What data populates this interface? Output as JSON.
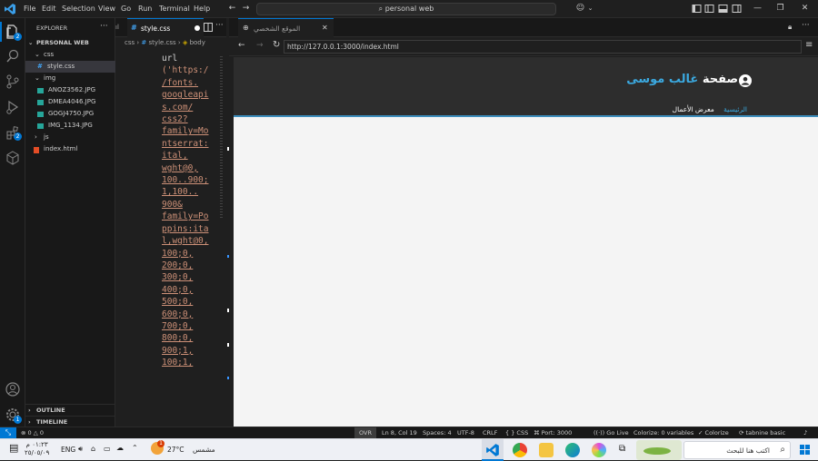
{
  "titlebar": {
    "menu": [
      "File",
      "Edit",
      "Selection",
      "View",
      "Go",
      "Run",
      "Terminal",
      "Help"
    ],
    "search": "personal web"
  },
  "activity": {
    "explorer_badge": "2",
    "scm_badge": "2",
    "settings_badge": "1"
  },
  "explorer": {
    "title": "EXPLORER",
    "workspace": "PERSONAL WEB",
    "tree": [
      {
        "label": "css",
        "type": "folder"
      },
      {
        "label": "style.css",
        "type": "css",
        "selected": true
      },
      {
        "label": "img",
        "type": "folder"
      },
      {
        "label": "ANOZ3562.JPG",
        "type": "image"
      },
      {
        "label": "DMEA4046.JPG",
        "type": "image"
      },
      {
        "label": "GOGJ4750.JPG",
        "type": "image"
      },
      {
        "label": "IMG_1134.JPG",
        "type": "image"
      },
      {
        "label": "js",
        "type": "folder"
      },
      {
        "label": "index.html",
        "type": "html"
      }
    ],
    "outline": "OUTLINE",
    "timeline": "TIMELINE"
  },
  "editor": {
    "tab_prev": "ıl",
    "tab_active": "style.css",
    "breadcrumb": [
      "css",
      "style.css",
      "body"
    ],
    "code_lines": [
      "url",
      "('https:/",
      "/fonts.",
      "googleapi",
      "s.com/",
      "css2?",
      "family=Mo",
      "ntserrat:",
      "ital,",
      "wght@0,",
      "100..900;",
      "1,100..",
      "900&",
      "family=Po",
      "ppins:ita",
      "l,wght@0,",
      "100;0,",
      "200;0,",
      "300;0,",
      "400;0,",
      "500;0,",
      "600;0,",
      "700;0,",
      "800;0,",
      "900;1,",
      "100;1,"
    ]
  },
  "browser": {
    "tab_title": "الموقع الشخصي",
    "url": "http://127.0.0.1:3000/index.html",
    "site_title_main": "صفحة",
    "site_title_accent": "غالب موسى",
    "nav": [
      {
        "label": "الرئيسية",
        "active": true
      },
      {
        "label": "معرض الأعمال",
        "active": false
      }
    ]
  },
  "statusbar": {
    "errors": "0",
    "warnings": "0",
    "ovr": "OVR",
    "position": "Ln 8, Col 19",
    "spaces": "Spaces: 4",
    "encoding": "UTF-8",
    "eol": "CRLF",
    "language": "CSS",
    "port": "Port: 3000",
    "golive": "Go Live",
    "colorize_vars": "Colorize: 0 variables",
    "colorize": "Colorize",
    "tabnine": "tabnine basic"
  },
  "taskbar": {
    "search_placeholder": "اكتب هنا للبحث",
    "weather_temp": "27°C",
    "weather_text": "مشمس",
    "weather_badge": "1",
    "lang": "ENG",
    "time": "٠١:٢٣ م",
    "date": "٢٥/٠٥/٠٩"
  },
  "colors": {
    "accent_blue": "#0078d4",
    "site_accent": "#3ba9e0",
    "css_string": "#ce9178"
  }
}
